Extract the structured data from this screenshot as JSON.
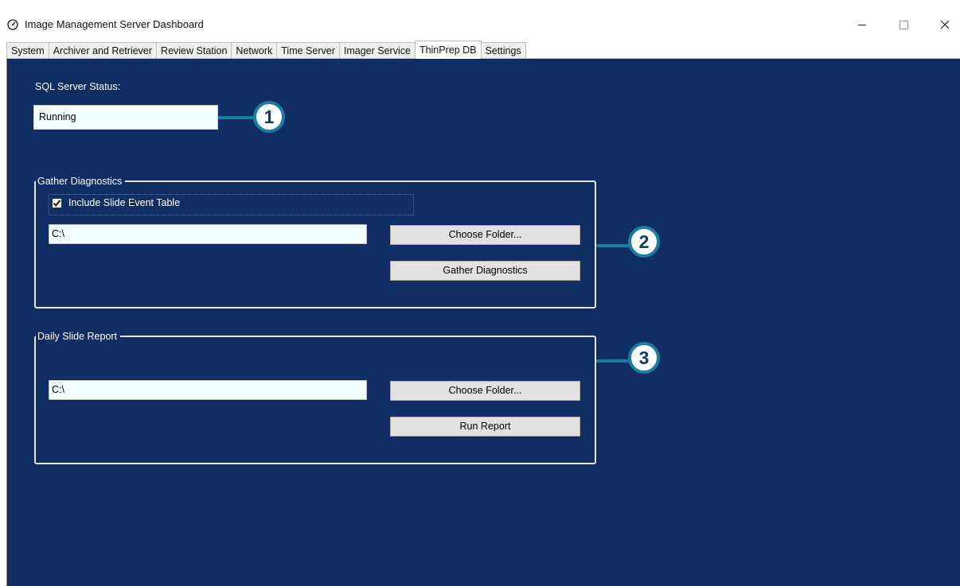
{
  "window": {
    "title": "Image Management Server Dashboard"
  },
  "tabs": [
    "System",
    "Archiver and Retriever",
    "Review Station",
    "Network",
    "Time Server",
    "Imager Service",
    "ThinPrep DB",
    "Settings"
  ],
  "active_tab": "ThinPrep DB",
  "sql_status": {
    "label": "SQL Server Status:",
    "value": "Running"
  },
  "gather": {
    "title": "Gather Diagnostics",
    "checkbox_label": "Include Slide Event Table",
    "checked": true,
    "path": "C:\\",
    "choose_label": "Choose Folder...",
    "action_label": "Gather Diagnostics"
  },
  "report": {
    "title": "Daily Slide Report",
    "path": "C:\\",
    "choose_label": "Choose Folder...",
    "action_label": "Run Report"
  },
  "callouts": [
    "1",
    "2",
    "3"
  ],
  "colors": {
    "panel": "#102e63",
    "callout": "#1a7ea0",
    "field": "#f2ffff"
  }
}
